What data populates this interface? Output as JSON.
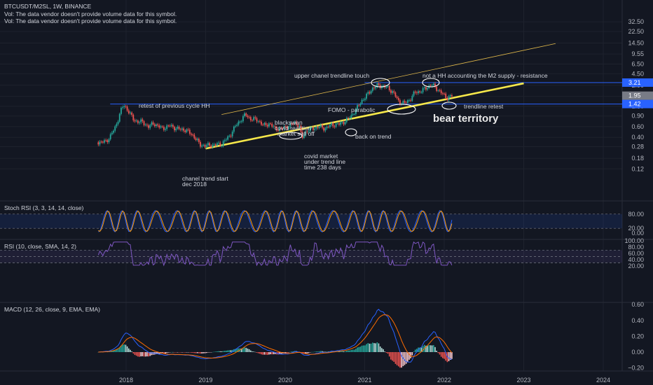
{
  "header": {
    "symbol_line": "BTCUSDT/M2SL, 1W, BINANCE",
    "vol_note_1": "Vol: The data vendor doesn't provide volume data for this symbol.",
    "vol_note_2": "Vol: The data vendor doesn't provide volume data for this symbol."
  },
  "colors": {
    "background": "#131722",
    "candle_up": "#26a69a",
    "candle_down": "#ef5350",
    "trendline": "#f7e84a",
    "hline": "#2962ff",
    "annotation": "#d1d4dc"
  },
  "panels": {
    "stoch_label": "Stoch RSI (3, 3, 14, 14, close)",
    "rsi_label": "RSI (10, close, SMA, 14, 2)",
    "macd_label": "MACD (12, 26, close, 9, EMA, EMA)"
  },
  "chart_data": [
    {
      "type": "candlestick",
      "title": "BTCUSDT/M2SL, 1W, BINANCE",
      "scale": "log",
      "x_ticks": [
        "2018",
        "2019",
        "2020",
        "2021",
        "2022",
        "2023",
        "2024"
      ],
      "y_ticks": [
        32.5,
        22.5,
        14.5,
        9.55,
        6.5,
        4.5,
        2.9,
        1.9,
        1.3,
        0.9,
        0.6,
        0.4,
        0.28,
        0.18,
        0.12
      ],
      "y_tick_labels": [
        "32.50",
        "22.50",
        "14.50",
        "9.55",
        "6.50",
        "4.50",
        "2.90",
        "1.90",
        "1.30",
        "0.90",
        "0.60",
        "0.40",
        "0.28",
        "0.18",
        "0.12"
      ],
      "price_badges": [
        "3.21",
        "1.95",
        "1.42"
      ],
      "price_badge_values": [
        3.21,
        1.95,
        1.42
      ],
      "horizontal_lines": [
        3.21,
        1.42
      ],
      "approx_close_by_time": [
        {
          "t": 2017.65,
          "v": 0.33
        },
        {
          "t": 2017.75,
          "v": 0.34
        },
        {
          "t": 2017.8,
          "v": 0.42
        },
        {
          "t": 2017.87,
          "v": 0.6
        },
        {
          "t": 2017.93,
          "v": 1.1
        },
        {
          "t": 2017.97,
          "v": 1.35
        },
        {
          "t": 2018.03,
          "v": 1.1
        },
        {
          "t": 2018.1,
          "v": 0.75
        },
        {
          "t": 2018.2,
          "v": 0.72
        },
        {
          "t": 2018.28,
          "v": 0.6
        },
        {
          "t": 2018.35,
          "v": 0.68
        },
        {
          "t": 2018.45,
          "v": 0.56
        },
        {
          "t": 2018.55,
          "v": 0.62
        },
        {
          "t": 2018.65,
          "v": 0.55
        },
        {
          "t": 2018.75,
          "v": 0.53
        },
        {
          "t": 2018.85,
          "v": 0.42
        },
        {
          "t": 2018.93,
          "v": 0.3
        },
        {
          "t": 2019.0,
          "v": 0.29
        },
        {
          "t": 2019.1,
          "v": 0.3
        },
        {
          "t": 2019.2,
          "v": 0.31
        },
        {
          "t": 2019.3,
          "v": 0.42
        },
        {
          "t": 2019.37,
          "v": 0.6
        },
        {
          "t": 2019.45,
          "v": 0.8
        },
        {
          "t": 2019.5,
          "v": 0.95
        },
        {
          "t": 2019.57,
          "v": 0.8
        },
        {
          "t": 2019.65,
          "v": 0.78
        },
        {
          "t": 2019.73,
          "v": 0.62
        },
        {
          "t": 2019.8,
          "v": 0.68
        },
        {
          "t": 2019.87,
          "v": 0.56
        },
        {
          "t": 2019.95,
          "v": 0.55
        },
        {
          "t": 2020.05,
          "v": 0.62
        },
        {
          "t": 2020.12,
          "v": 0.7
        },
        {
          "t": 2020.18,
          "v": 0.6
        },
        {
          "t": 2020.21,
          "v": 0.38
        },
        {
          "t": 2020.26,
          "v": 0.5
        },
        {
          "t": 2020.33,
          "v": 0.55
        },
        {
          "t": 2020.42,
          "v": 0.6
        },
        {
          "t": 2020.5,
          "v": 0.56
        },
        {
          "t": 2020.58,
          "v": 0.64
        },
        {
          "t": 2020.68,
          "v": 0.66
        },
        {
          "t": 2020.76,
          "v": 0.75
        },
        {
          "t": 2020.83,
          "v": 0.9
        },
        {
          "t": 2020.9,
          "v": 1.2
        },
        {
          "t": 2020.96,
          "v": 1.6
        },
        {
          "t": 2021.03,
          "v": 2.0
        },
        {
          "t": 2021.1,
          "v": 2.6
        },
        {
          "t": 2021.17,
          "v": 2.9
        },
        {
          "t": 2021.23,
          "v": 2.8
        },
        {
          "t": 2021.3,
          "v": 2.6
        },
        {
          "t": 2021.37,
          "v": 2.1
        },
        {
          "t": 2021.42,
          "v": 1.6
        },
        {
          "t": 2021.5,
          "v": 1.45
        },
        {
          "t": 2021.57,
          "v": 1.7
        },
        {
          "t": 2021.63,
          "v": 2.2
        },
        {
          "t": 2021.7,
          "v": 2.3
        },
        {
          "t": 2021.77,
          "v": 2.6
        },
        {
          "t": 2021.84,
          "v": 3.0
        },
        {
          "t": 2021.9,
          "v": 2.6
        },
        {
          "t": 2021.96,
          "v": 2.2
        },
        {
          "t": 2022.03,
          "v": 1.8
        },
        {
          "t": 2022.1,
          "v": 1.95
        }
      ]
    },
    {
      "type": "line",
      "title": "Stoch RSI (3, 3, 14, 14, close)",
      "y_ticks": [
        "80.00",
        "20.00",
        "0.00"
      ],
      "ylim": [
        0,
        100
      ]
    },
    {
      "type": "line",
      "title": "RSI (10, close, SMA, 14, 2)",
      "y_ticks": [
        "100.00",
        "80.00",
        "60.00",
        "40.00",
        "20.00"
      ],
      "ylim": [
        15,
        100
      ]
    },
    {
      "type": "bar",
      "title": "MACD (12, 26, close, 9, EMA, EMA)",
      "y_ticks": [
        "0.60",
        "0.40",
        "0.20",
        "0.00",
        "−0.20"
      ],
      "ylim": [
        -0.25,
        0.62
      ]
    }
  ],
  "annotations": {
    "prev_hh": "retest of previous cycle HH",
    "upper_touch": "upper chanel trendline touch",
    "not_hh": "not a HH accounting the M2 supply - resistance",
    "fomo": "FOMO - parabolic",
    "bear": "bear territory",
    "retest": "trendline retest",
    "blackswan_1": "blackswan",
    "blackswan_2": "covid reaction",
    "blackswan_3": "market sell off",
    "back_on_trend": "back on trend",
    "covid_1": "covid market",
    "covid_2": "under trend line",
    "covid_3": "time 238 days",
    "chanel_1": "chanel trend start",
    "chanel_2": "dec 2018"
  }
}
